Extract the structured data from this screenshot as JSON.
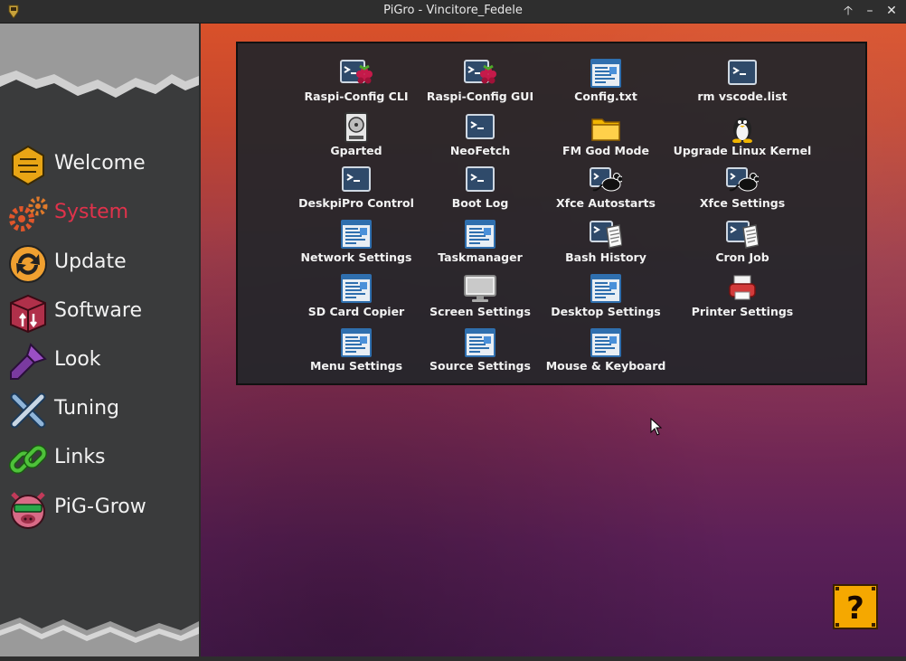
{
  "window": {
    "title": "PiGro - Vincitore_Fedele",
    "buttons": {
      "maximize": "🡡",
      "minimize": "–",
      "close": "✕"
    }
  },
  "sidebar": {
    "items": [
      {
        "label": "Welcome",
        "icon": "honeycomb-icon",
        "active": false
      },
      {
        "label": "System",
        "icon": "gears-icon",
        "active": true
      },
      {
        "label": "Update",
        "icon": "refresh-arrows-icon",
        "active": false
      },
      {
        "label": "Software",
        "icon": "package-box-icon",
        "active": false
      },
      {
        "label": "Look",
        "icon": "paintbrush-icon",
        "active": false
      },
      {
        "label": "Tuning",
        "icon": "wrench-screwdriver-icon",
        "active": false
      },
      {
        "label": "Links",
        "icon": "chain-link-icon",
        "active": false
      },
      {
        "label": "PiG-Grow",
        "icon": "pig-face-icon",
        "active": false
      }
    ],
    "colors": {
      "background": "#3a3b3c",
      "active_label": "#e0324b",
      "label": "#f2f2f2"
    }
  },
  "panel": {
    "tiles": [
      {
        "label": "Raspi-Config CLI",
        "icon": "terminal-raspberry-icon"
      },
      {
        "label": "Raspi-Config GUI",
        "icon": "terminal-raspberry-icon"
      },
      {
        "label": "Config.txt",
        "icon": "text-editor-icon"
      },
      {
        "label": "rm vscode.list",
        "icon": "terminal-icon"
      },
      {
        "label": "Gparted",
        "icon": "hard-disk-icon"
      },
      {
        "label": "NeoFetch",
        "icon": "terminal-icon"
      },
      {
        "label": "FM God Mode",
        "icon": "folder-icon"
      },
      {
        "label": "Upgrade Linux Kernel",
        "icon": "tux-penguin-icon"
      },
      {
        "label": "DeskpiPro Control",
        "icon": "terminal-icon"
      },
      {
        "label": "Boot Log",
        "icon": "terminal-icon"
      },
      {
        "label": "Xfce Autostarts",
        "icon": "xfce-mouse-icon"
      },
      {
        "label": "Xfce Settings",
        "icon": "xfce-mouse-icon"
      },
      {
        "label": "Network Settings",
        "icon": "text-editor-icon"
      },
      {
        "label": "Taskmanager",
        "icon": "text-editor-icon"
      },
      {
        "label": "Bash History",
        "icon": "terminal-document-icon"
      },
      {
        "label": "Cron Job",
        "icon": "terminal-document-icon"
      },
      {
        "label": "SD Card Copier",
        "icon": "text-editor-icon"
      },
      {
        "label": "Screen Settings",
        "icon": "monitor-icon"
      },
      {
        "label": "Desktop Settings",
        "icon": "text-editor-icon"
      },
      {
        "label": "Printer Settings",
        "icon": "printer-icon"
      },
      {
        "label": "Menu Settings",
        "icon": "text-editor-icon"
      },
      {
        "label": "Source Settings",
        "icon": "text-editor-icon"
      },
      {
        "label": "Mouse & Keyboard",
        "icon": "text-editor-icon"
      }
    ]
  },
  "help": {
    "glyph": "?",
    "icon": "question-block-icon"
  },
  "colors": {
    "accent": "#e0324b",
    "desktop_top": "#d9512a",
    "desktop_bottom": "#4a1b50",
    "help_block": "#f5a800"
  }
}
